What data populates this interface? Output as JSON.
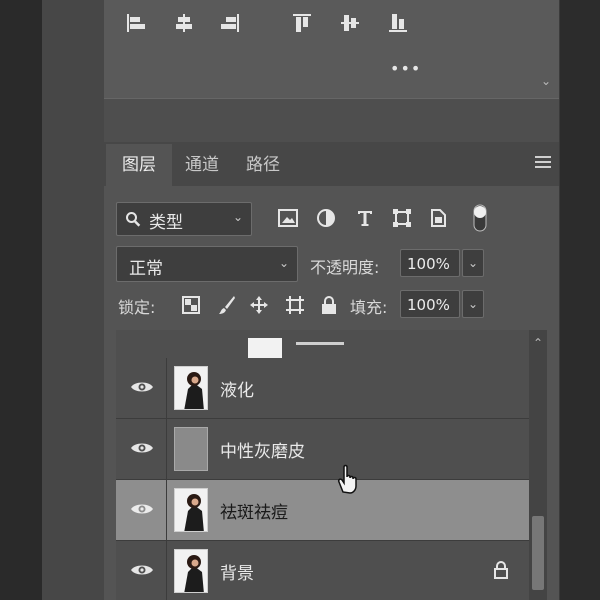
{
  "align_panel": {
    "icons": [
      "align-left-edges-icon",
      "align-horizontal-centers-icon",
      "align-right-edges-icon",
      "align-top-edges-icon",
      "align-vertical-centers-icon",
      "align-bottom-edges-icon"
    ],
    "more_label": "•••"
  },
  "layers_panel": {
    "tabs": [
      {
        "label": "图层",
        "active": true
      },
      {
        "label": "通道",
        "active": false
      },
      {
        "label": "路径",
        "active": false
      }
    ],
    "filter": {
      "kind_label": "类型",
      "icons": [
        "pixel-filter-icon",
        "adjustment-filter-icon",
        "type-filter-icon",
        "shape-filter-icon",
        "smart-object-filter-icon",
        "filter-toggle-icon"
      ]
    },
    "blend_mode": "正常",
    "opacity_label": "不透明度:",
    "opacity_value": "100%",
    "lock_label": "锁定:",
    "fill_label": "填充:",
    "fill_value": "100%",
    "layers": [
      {
        "name": "液化",
        "visible": true,
        "selected": false,
        "locked": false,
        "thumb": "photo"
      },
      {
        "name": "中性灰磨皮",
        "visible": true,
        "selected": false,
        "locked": false,
        "thumb": "gray"
      },
      {
        "name": "祛斑祛痘",
        "visible": true,
        "selected": true,
        "locked": false,
        "thumb": "photo"
      },
      {
        "name": "背景",
        "visible": true,
        "selected": false,
        "locked": true,
        "thumb": "photo"
      }
    ]
  },
  "colors": {
    "panel": "#545454",
    "selected_row": "#8e8e8e",
    "dark_input": "#3e3e3e"
  }
}
